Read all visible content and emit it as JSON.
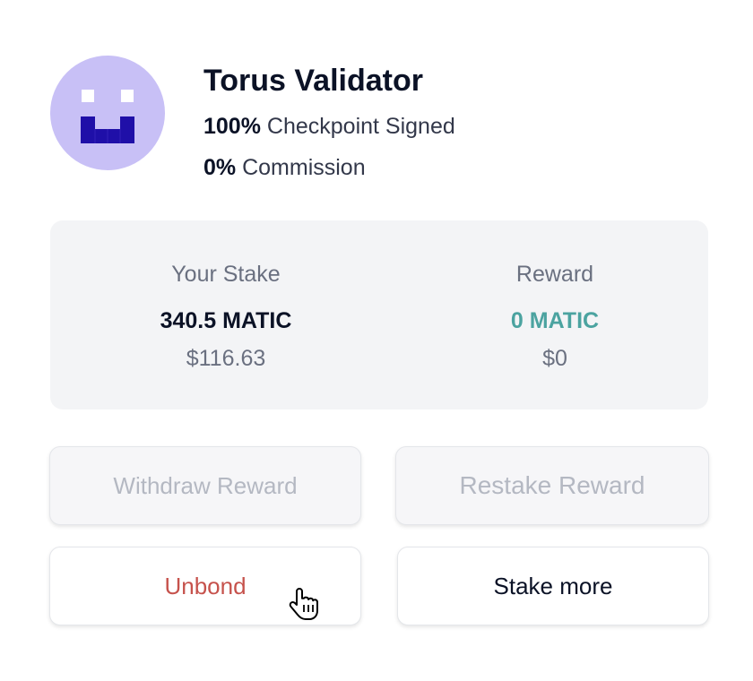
{
  "validator": {
    "name": "Torus Validator",
    "checkpoint_value": "100%",
    "checkpoint_label": "Checkpoint Signed",
    "commission_value": "0%",
    "commission_label": "Commission",
    "avatar_bg_color": "#c8c0f6",
    "avatar_fg_color": "#1f0fa8"
  },
  "stake": {
    "your_stake_label": "Your Stake",
    "your_stake_amount": "340.5 MATIC",
    "your_stake_fiat": "$116.63",
    "reward_label": "Reward",
    "reward_amount": "0 MATIC",
    "reward_fiat": "$0",
    "reward_color": "#4ba3a0"
  },
  "actions": {
    "withdraw_label": "Withdraw Reward",
    "restake_label": "Restake Reward",
    "unbond_label": "Unbond",
    "stake_more_label": "Stake more",
    "unbond_color": "#c6524c"
  },
  "cursor": {
    "icon": "hand-pointer-icon"
  }
}
